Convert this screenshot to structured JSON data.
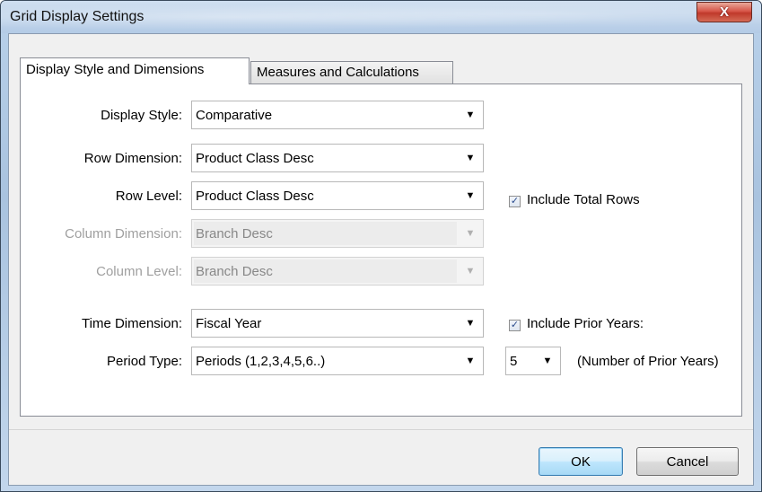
{
  "window": {
    "title": "Grid Display Settings",
    "close_glyph": "X"
  },
  "tabs": [
    {
      "label": "Display Style and Dimensions",
      "active": true
    },
    {
      "label": "Measures and Calculations",
      "active": false
    }
  ],
  "form": {
    "display_style": {
      "label": "Display Style:",
      "value": "Comparative"
    },
    "row_dimension": {
      "label": "Row Dimension:",
      "value": "Product Class Desc"
    },
    "row_level": {
      "label": "Row Level:",
      "value": "Product Class Desc"
    },
    "column_dimension": {
      "label": "Column Dimension:",
      "value": "Branch Desc",
      "enabled": false
    },
    "column_level": {
      "label": "Column Level:",
      "value": "Branch Desc",
      "enabled": false
    },
    "time_dimension": {
      "label": "Time Dimension:",
      "value": "Fiscal Year"
    },
    "period_type": {
      "label": "Period Type:",
      "value": "Periods (1,2,3,4,5,6..)"
    },
    "include_total_rows": {
      "label": "Include Total Rows",
      "checked": true
    },
    "include_prior_years": {
      "label": "Include Prior Years:",
      "checked": true
    },
    "prior_years_count": {
      "value": "5"
    },
    "prior_years_note": "(Number of Prior Years)"
  },
  "buttons": {
    "ok": "OK",
    "cancel": "Cancel"
  },
  "icons": {
    "dropdown": "chevron-down-icon",
    "check": "checkmark-icon",
    "close": "close-icon"
  },
  "colors": {
    "title_bar": "#b9d1ea",
    "close_button": "#c0392b",
    "dialog_bg": "#f0f0f0",
    "checkbox_mark": "#2a4b8d",
    "disabled_text": "#a0a0a0"
  }
}
